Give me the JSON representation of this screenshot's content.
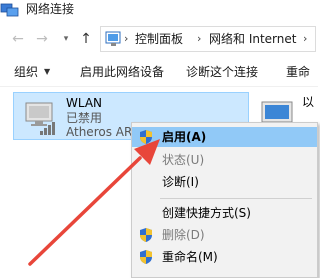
{
  "window": {
    "title": "网络连接",
    "icon": "network-connections-icon"
  },
  "address_bar": {
    "back_icon": "back-arrow-icon",
    "forward_icon": "forward-arrow-icon",
    "recent_icon": "chevron-down-icon",
    "up_icon": "up-arrow-icon",
    "location_icon": "control-panel-icon",
    "breadcrumbs": [
      "控制面板",
      "网络和 Internet"
    ],
    "separator": "›"
  },
  "toolbar": {
    "items": [
      {
        "label": "组织",
        "has_dropdown": true
      },
      {
        "label": "启用此网络设备"
      },
      {
        "label": "诊断这个连接"
      },
      {
        "label": "重命"
      }
    ]
  },
  "connections": [
    {
      "name": "WLAN",
      "status": "已禁用",
      "adapter": "Atheros AR",
      "icon": "wireless-adapter-icon",
      "selected": true
    },
    {
      "name": "以",
      "icon": "ethernet-adapter-icon",
      "selected": false
    }
  ],
  "context_menu": {
    "items": [
      {
        "label": "启用(A)",
        "bold": true,
        "highlighted": true,
        "icon": "uac-shield-icon"
      },
      {
        "label": "状态(U)",
        "disabled": true
      },
      {
        "label": "诊断(I)"
      },
      {
        "separator": true
      },
      {
        "label": "创建快捷方式(S)"
      },
      {
        "label": "删除(D)",
        "disabled": true,
        "icon": "uac-shield-icon"
      },
      {
        "label": "重命名(M)",
        "icon": "uac-shield-icon"
      }
    ]
  },
  "colors": {
    "selection_fill": "#cce8ff",
    "menu_highlight": "#91c9f7",
    "annotation_arrow": "#e8463a"
  }
}
